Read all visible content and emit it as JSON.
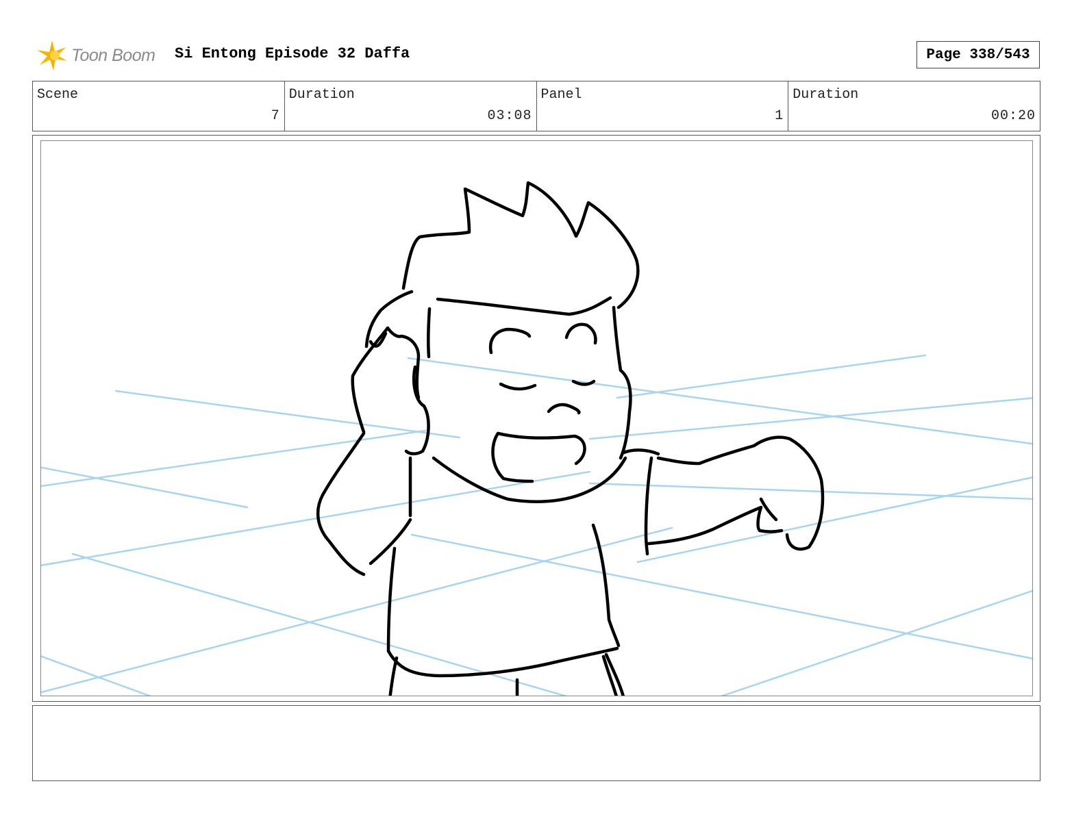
{
  "header": {
    "logo_text": "Toon Boom",
    "project_title": "Si Entong Episode 32 Daffa",
    "page_label": "Page 338/543"
  },
  "info": {
    "scene_label": "Scene",
    "scene_value": "7",
    "scene_duration_label": "Duration",
    "scene_duration_value": "03:08",
    "panel_label": "Panel",
    "panel_value": "1",
    "panel_duration_label": "Duration",
    "panel_duration_value": "00:20"
  },
  "panel": {
    "drawing": "sketch-of-boy-holding-head-and-reaching-out",
    "guide_line_color": "#a9d4ee",
    "sketch_line_color": "#000000"
  },
  "notes": {
    "text": ""
  },
  "colors": {
    "logo_star": "#f5b400",
    "logo_text": "#8a8a8a",
    "border": "#555555"
  }
}
